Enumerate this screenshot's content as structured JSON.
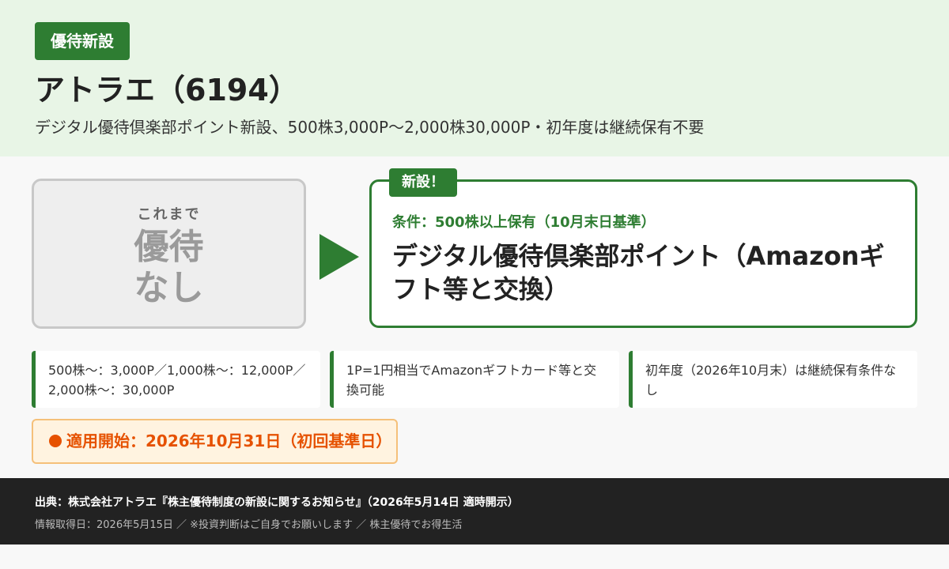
{
  "header": {
    "badge": "優待新設",
    "title": "アトラエ（6194）",
    "subtitle": "デジタル優待倶楽部ポイント新設、500株3,000P〜2,000株30,000P・初年度は継続保有不要"
  },
  "before": {
    "label": "これまで",
    "value_line1": "優待",
    "value_line2": "なし"
  },
  "after": {
    "tag": "新設！",
    "condition": "条件：500株以上保有（10月末日基準）",
    "benefit": "デジタル優待倶楽部ポイント（Amazonギフト等と交換）"
  },
  "details": [
    "500株〜：3,000P／1,000株〜：12,000P／2,000株〜：30,000P",
    "1P=1円相当でAmazonギフトカード等と交換可能",
    "初年度（2026年10月末）は継続保有条件なし"
  ],
  "start": {
    "text": "適用開始：2026年10月31日（初回基準日）"
  },
  "footer": {
    "source": "出典：株式会社アトラエ『株主優待制度の新設に関するお知らせ』（2026年5月14日 適時開示）",
    "fetched": "情報取得日：2026年5月15日 ／ ※投資判断はご自身でお願いします ／ 株主優待でお得生活"
  },
  "colors": {
    "accent": "#2e7d32",
    "header_bg": "#e8f5e6",
    "warning": "#e65100",
    "footer_bg": "#222222"
  }
}
